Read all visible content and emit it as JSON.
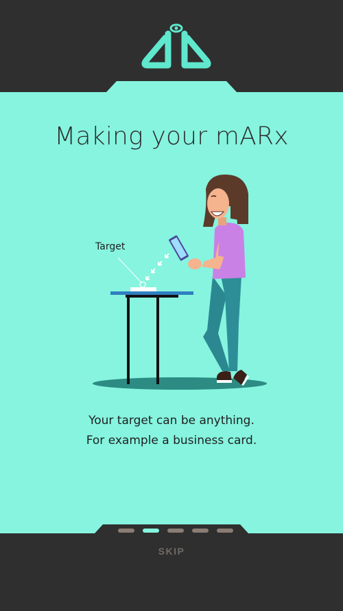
{
  "app": {
    "logo_icon": "marx-logo-icon"
  },
  "onboarding": {
    "title": "Making your mARx",
    "target_label": "Target",
    "caption_line1": "Your target can be anything.",
    "caption_line2": "For example a business card.",
    "skip_label": "SKIP",
    "page_count": 5,
    "current_page": 2
  },
  "colors": {
    "background_dark": "#2f2f2f",
    "accent_mint": "#86f4df",
    "logo_mint": "#5fe8cd",
    "dot_inactive": "#8a7d74",
    "skip_text": "#6f6a66"
  }
}
